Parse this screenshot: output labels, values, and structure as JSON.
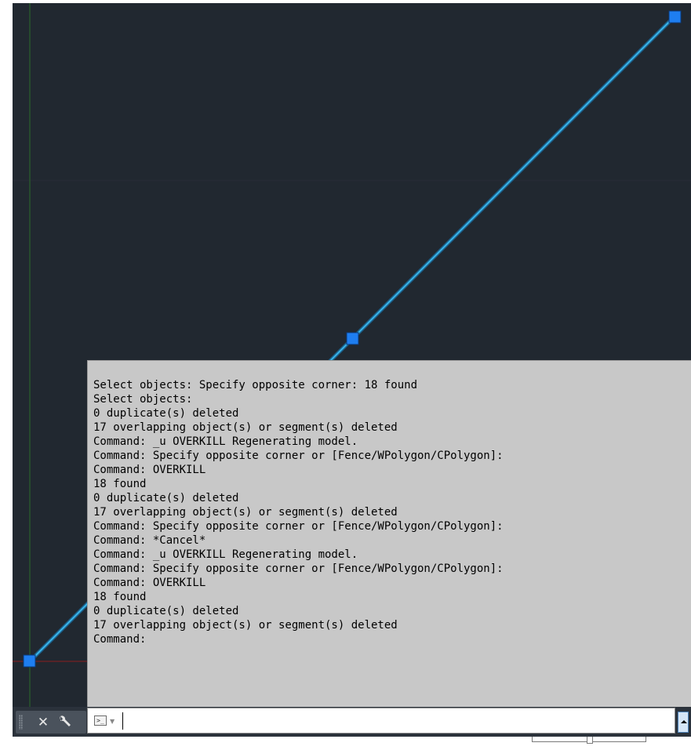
{
  "command_history": {
    "lines": [
      "Select objects: Specify opposite corner: 18 found",
      "Select objects:",
      "0 duplicate(s) deleted",
      "17 overlapping object(s) or segment(s) deleted",
      "Command: _u OVERKILL Regenerating model.",
      "Command: Specify opposite corner or [Fence/WPolygon/CPolygon]:",
      "Command: OVERKILL",
      "18 found",
      "0 duplicate(s) deleted",
      "17 overlapping object(s) or segment(s) deleted",
      "Command: Specify opposite corner or [Fence/WPolygon/CPolygon]:",
      "Command: *Cancel*",
      "Command: _u OVERKILL Regenerating model.",
      "Command: Specify opposite corner or [Fence/WPolygon/CPolygon]:",
      "Command: OVERKILL",
      "18 found",
      "0 duplicate(s) deleted",
      "17 overlapping object(s) or segment(s) deleted",
      "Command:"
    ]
  },
  "command_line": {
    "input_value": "",
    "close_icon": "close-icon",
    "customize_icon": "wrench-icon",
    "prompt_icon": "command-prompt-icon",
    "prompt_glyph": ">_",
    "prompt_caret": "▼"
  },
  "colors": {
    "canvas": "#212830",
    "selected_line": "#39b4e8",
    "grip": "#1e7ef0",
    "history_bg": "#c8c8c8",
    "x_axis": "#8b1e1e",
    "y_axis": "#2a6b2a"
  }
}
